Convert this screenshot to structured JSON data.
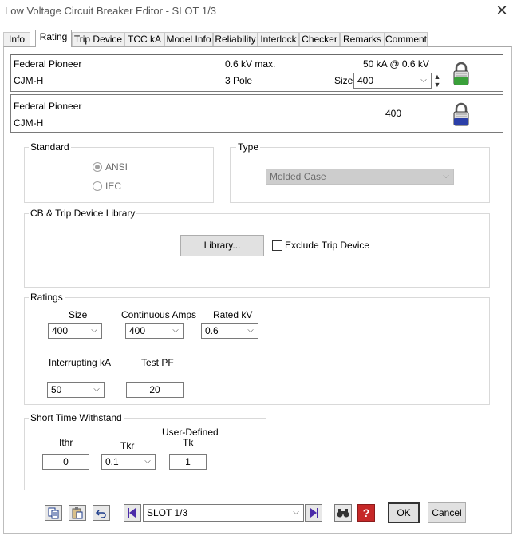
{
  "window": {
    "title": "Low Voltage Circuit Breaker Editor - SLOT 1/3"
  },
  "tabs": [
    {
      "label": "Info"
    },
    {
      "label": "Rating"
    },
    {
      "label": "Trip Device"
    },
    {
      "label": "TCC kA"
    },
    {
      "label": "Model Info"
    },
    {
      "label": "Reliability"
    },
    {
      "label": "Interlock"
    },
    {
      "label": "Checker"
    },
    {
      "label": "Remarks"
    },
    {
      "label": "Comment"
    }
  ],
  "header1": {
    "manufacturer": "Federal Pioneer",
    "model": "CJM-H",
    "voltage": "0.6 kV max.",
    "poles": "3 Pole",
    "rating": "50 kA @ 0.6 kV",
    "size_label": "Size",
    "size_value": "400",
    "lock_color": "#3aa03a"
  },
  "header2": {
    "manufacturer": "Federal Pioneer",
    "model": "CJM-H",
    "size_value": "400",
    "lock_color": "#2b3fa8"
  },
  "standard": {
    "label": "Standard",
    "options": [
      {
        "label": "ANSI",
        "checked": true
      },
      {
        "label": "IEC",
        "checked": false
      }
    ]
  },
  "type": {
    "label": "Type",
    "value": "Molded Case"
  },
  "library": {
    "label": "CB & Trip Device Library",
    "button_label": "Library...",
    "exclude_label": "Exclude Trip Device"
  },
  "ratings": {
    "label": "Ratings",
    "size_label": "Size",
    "size_value": "400",
    "cont_amps_label": "Continuous Amps",
    "cont_amps_value": "400",
    "rated_kv_label": "Rated kV",
    "rated_kv_value": "0.6",
    "interrupting_label": "Interrupting kA",
    "interrupting_value": "50",
    "test_pf_label": "Test PF",
    "test_pf_value": "20"
  },
  "stw": {
    "label": "Short Time Withstand",
    "ithr_label": "Ithr",
    "ithr_value": "0",
    "tkr_label": "Tkr",
    "tkr_value": "0.1",
    "tk_label_line1": "User-Defined",
    "tk_label_line2": "Tk",
    "tk_value": "1"
  },
  "footer": {
    "slot_value": "SLOT 1/3",
    "ok_label": "OK",
    "cancel_label": "Cancel"
  }
}
